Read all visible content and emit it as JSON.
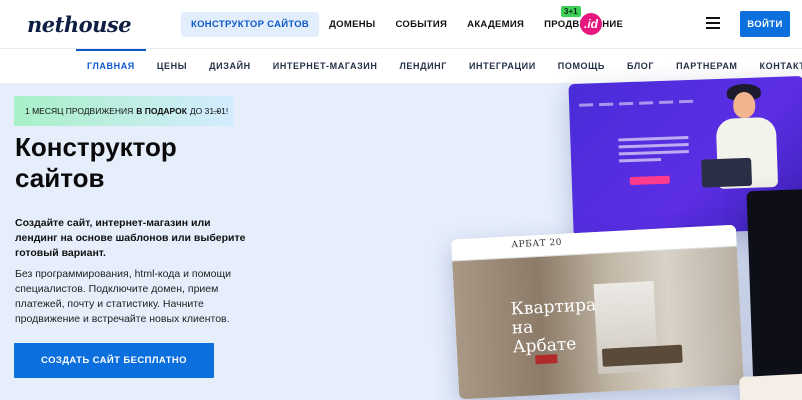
{
  "header": {
    "logo": "nethouse",
    "nav": [
      "КОНСТРУКТОР САЙТОВ",
      "ДОМЕНЫ",
      "СОБЫТИЯ",
      "АКАДЕМИЯ",
      "ПРОДВИЖЕНИЕ"
    ],
    "active_nav_index": 0,
    "promo_badge": "3+1",
    "id_logo": ".id",
    "login_label": "ВОЙТИ"
  },
  "subnav": {
    "items": [
      "ГЛАВНАЯ",
      "ЦЕНЫ",
      "ДИЗАЙН",
      "ИНТЕРНЕТ-МАГАЗИН",
      "ЛЕНДИНГ",
      "ИНТЕГРАЦИИ",
      "ПОМОЩЬ",
      "БЛОГ",
      "ПАРТНЕРАМ",
      "КОНТАКТЫ"
    ],
    "active_index": 0
  },
  "hero": {
    "promo_prefix": "1 МЕСЯЦ ПРОДВИЖЕНИЯ",
    "promo_bold": "В ПОДАРОК",
    "promo_suffix": "ДО 31.01!",
    "promo_arrow": "→",
    "title": "Конструктор сайтов",
    "subtitle": "Создайте сайт, интернет-магазин или лендинг на основе шаблонов или выберите готовый вариант.",
    "description": "Без программирования, html-кода и помощи специалистов. Подключите домен, прием платежей, почту и статистику. Начните продвижение и встречайте новых клиентов.",
    "cta_label": "СОЗДАТЬ САЙТ БЕСПЛАТНО"
  },
  "mockups": {
    "arbat_logo": "АРБАТ 20",
    "arbat_heading": "Квартира на Арбате"
  },
  "colors": {
    "accent": "#0b6fde",
    "promo_green": "#3fcf59",
    "id_pink": "#e6187d",
    "page_bg": "#e6eefc"
  }
}
